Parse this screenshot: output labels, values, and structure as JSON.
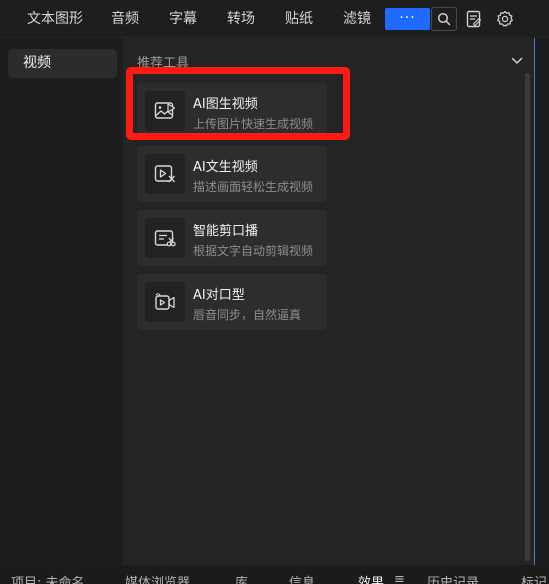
{
  "top_tabs": [
    "文本图形",
    "音频",
    "字幕",
    "转场",
    "贴纸",
    "滤镜"
  ],
  "more_label": "···",
  "icons": {
    "search": "search-icon",
    "note": "note-icon",
    "settings": "gear-icon",
    "collapse": "chevron-down-icon"
  },
  "sidebar": {
    "items": [
      {
        "label": "视频",
        "selected": true
      }
    ]
  },
  "section": {
    "title": "推荐工具"
  },
  "cards": [
    {
      "title": "AI图生视频",
      "subtitle": "上传图片快速生成视频",
      "icon": "image-to-video-icon"
    },
    {
      "title": "AI文生视频",
      "subtitle": "描述画面轻松生成视频",
      "icon": "text-to-video-icon"
    },
    {
      "title": "智能剪口播",
      "subtitle": "根据文字自动剪辑视频",
      "icon": "smart-cut-icon"
    },
    {
      "title": "AI对口型",
      "subtitle": "唇音同步，自然逼真",
      "icon": "lip-sync-icon"
    }
  ],
  "bottom_tabs": [
    "项目: 未命名",
    "媒体浏览器",
    "库",
    "信息",
    "效果",
    "≡",
    "历史记录",
    "标记"
  ],
  "colors": {
    "accent": "#1f6bff",
    "highlight": "#ff1a12",
    "panel_border": "#4a7bd1"
  }
}
